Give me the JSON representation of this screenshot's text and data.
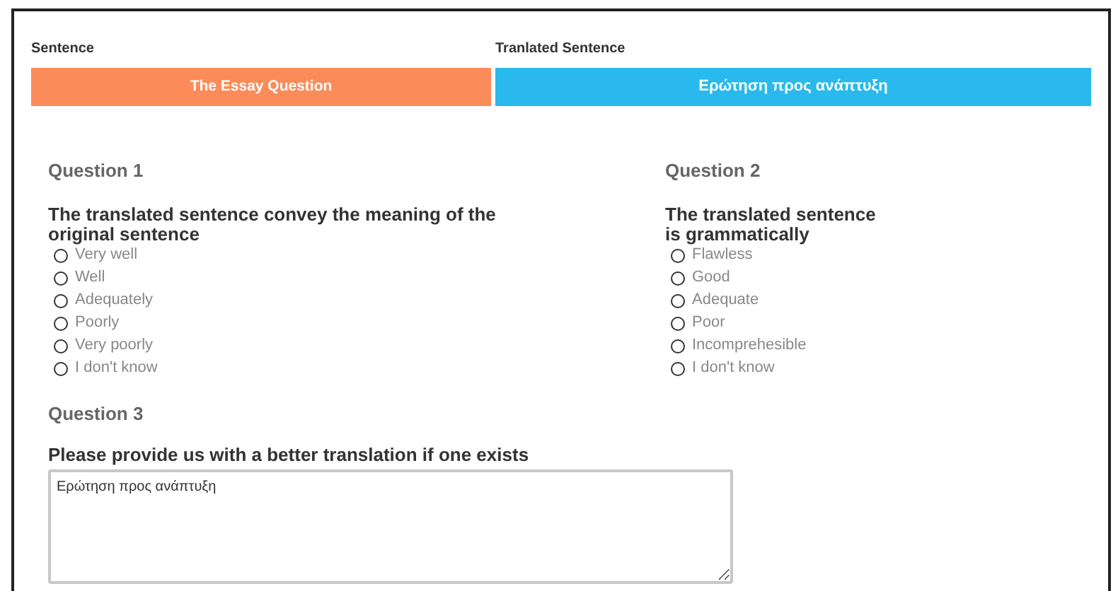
{
  "header": {
    "sentence_label": "Sentence",
    "translated_label": "Tranlated Sentence",
    "sentence": "The Essay Question",
    "translated": "Ερώτηση προς ανάπτυξη"
  },
  "questions": [
    {
      "title": "Question 1",
      "prompt": "The translated sentence convey the meaning of the original sentence",
      "options": [
        {
          "label": "Very well",
          "selected": false
        },
        {
          "label": "Well",
          "selected": false
        },
        {
          "label": "Adequately",
          "selected": false
        },
        {
          "label": "Poorly",
          "selected": false
        },
        {
          "label": "Very poorly",
          "selected": false
        },
        {
          "label": "I don't know",
          "selected": false
        }
      ]
    },
    {
      "title": "Question 2",
      "prompt": "The translated sentence is grammatically",
      "options": [
        {
          "label": "Flawless",
          "selected": false
        },
        {
          "label": "Good",
          "selected": false
        },
        {
          "label": "Adequate",
          "selected": false
        },
        {
          "label": "Poor",
          "selected": false
        },
        {
          "label": "Incomprehesible",
          "selected": false
        },
        {
          "label": "I don't know",
          "selected": false
        }
      ]
    }
  ],
  "question_3": {
    "title": "Question 3",
    "prompt": "Please provide us with a better translation if one exists",
    "value": "Ερώτηση προς ανάπτυξη"
  }
}
